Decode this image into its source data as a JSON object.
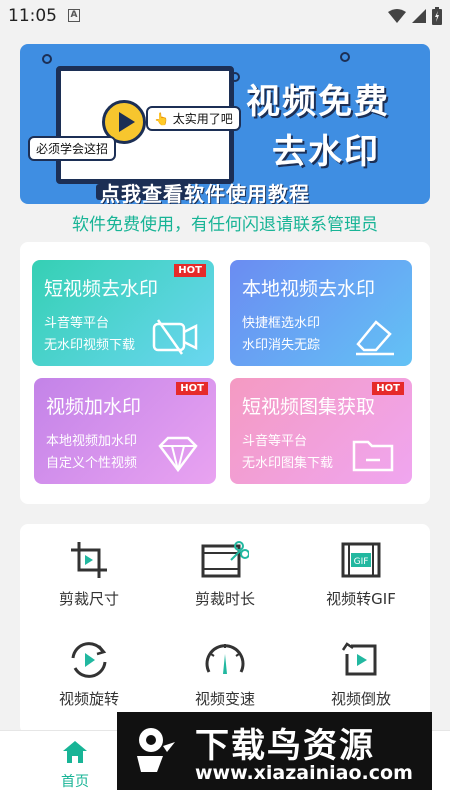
{
  "status_bar": {
    "time": "11:05",
    "notif_glyph": "A"
  },
  "banner": {
    "bubble_1": "👆 太实用了吧",
    "bubble_2": "必须学会这招",
    "title_line1": "视频免费",
    "title_line2": "去水印",
    "cta": "点我查看软件使用教程"
  },
  "notice": "软件免费使用，有任何闪退请联系管理员",
  "features": [
    {
      "title": "短视频去水印",
      "desc1": "斗音等平台",
      "desc2": "无水印视频下载",
      "badge": "HOT",
      "icon": "video-off-icon"
    },
    {
      "title": "本地视频去水印",
      "desc1": "快捷框选水印",
      "desc2": "水印消失无踪",
      "badge": "",
      "icon": "eraser-icon"
    },
    {
      "title": "视频加水印",
      "desc1": "本地视频加水印",
      "desc2": "自定义个性视频",
      "badge": "HOT",
      "icon": "diamond-icon"
    },
    {
      "title": "短视频图集获取",
      "desc1": "斗音等平台",
      "desc2": "无水印图集下载",
      "badge": "HOT",
      "icon": "folder-icon"
    }
  ],
  "tools": [
    {
      "label": "剪裁尺寸",
      "icon": "crop-icon"
    },
    {
      "label": "剪裁时长",
      "icon": "film-cut-icon"
    },
    {
      "label": "视频转GIF",
      "icon": "gif-icon"
    },
    {
      "label": "视频旋转",
      "icon": "rotate-icon"
    },
    {
      "label": "视频变速",
      "icon": "speedometer-icon"
    },
    {
      "label": "视频倒放",
      "icon": "reverse-icon"
    }
  ],
  "nav": {
    "home_label": "首页"
  },
  "watermark": {
    "line1": "下载鸟资源",
    "line2": "www.xiazainiao.com"
  },
  "colors": {
    "accent": "#18b496",
    "banner_bg": "#3f8ee2",
    "hot": "#e62a2a"
  }
}
